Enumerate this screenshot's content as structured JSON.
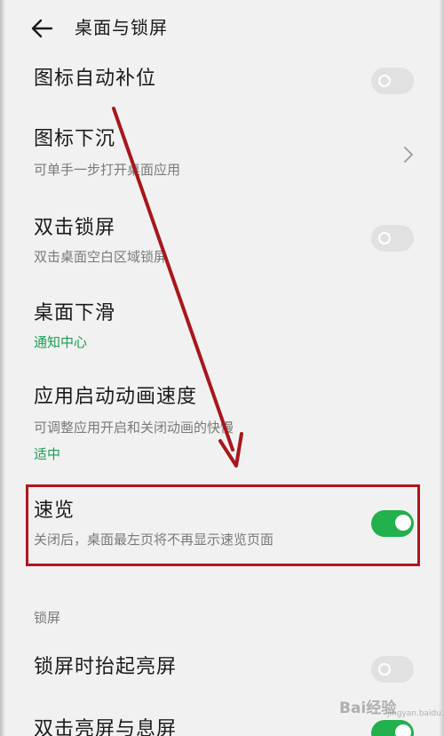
{
  "header": {
    "title": "桌面与锁屏"
  },
  "settings": [
    {
      "title": "图标自动补位",
      "toggle": false
    },
    {
      "title": "图标下沉",
      "subtitle": "可单手一步打开桌面应用"
    },
    {
      "title": "双击锁屏",
      "subtitle": "双击桌面空白区域锁屏",
      "toggle": false
    },
    {
      "title": "桌面下滑",
      "value": "通知中心"
    },
    {
      "title": "应用启动动画速度",
      "subtitle": "可调整应用开启和关闭动画的快慢",
      "value": "适中"
    },
    {
      "title": "速览",
      "subtitle": "关闭后，桌面最左页将不再显示速览页面",
      "toggle": true
    }
  ],
  "lock_section": {
    "label": "锁屏",
    "items": [
      {
        "title": "锁屏时抬起亮屏",
        "toggle": false
      },
      {
        "title": "双击亮屏与息屏",
        "toggle": true
      }
    ]
  },
  "annotation": {
    "box_color": "#b3141c",
    "arrow_color": "#a8161c"
  },
  "colors": {
    "accent": "#22b14c",
    "value_text": "#1e9d52",
    "background": "#f1f1f1"
  },
  "watermark": {
    "logo": "Bai经验",
    "site": "jingyan.baidu.com"
  }
}
